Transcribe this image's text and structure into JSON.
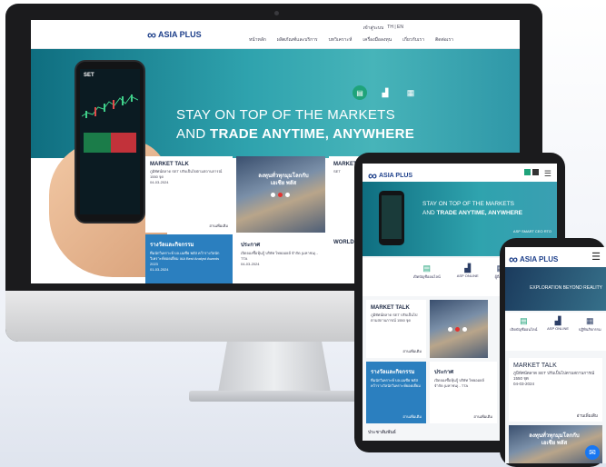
{
  "brand": {
    "logo_text": "ASIA PLUS",
    "logo_mark": "∞"
  },
  "desktop": {
    "user_bar": [
      "เข้าสู่ระบบ",
      "TH | EN"
    ],
    "nav": [
      "หน้าหลัก",
      "ผลิตภัณฑ์และบริการ",
      "บทวิเคราะห์",
      "เครื่องมือลงทุน",
      "เกี่ยวกับเรา",
      "ติดต่อเรา"
    ],
    "hero_line1": "STAY ON TOP OF THE  MARKETS",
    "hero_line2_bold": "TRADE  ANYTIME, ANYWHERE",
    "hero_line2_prefix": "AND ",
    "phone_ticker": "SET",
    "cards": [
      {
        "title": "MARKET TALK",
        "text": "ภูมิทัศน์ตลาด SET ปรับเป็นไปตามสถานการณ์ 1550 จุด",
        "date": "04-03-2024",
        "more": "อ่านเพิ่มเติม"
      },
      {
        "title": "รางวัลและกิจกรรม",
        "text": "ทีมนักวิเคราะห์ บล.เอเซีย พลัส คว้ารางวัลนักวิเคราะห์ยอดเยี่ยม IAA Best Analyst Awards 2023",
        "date": "01-03-2024"
      },
      {
        "title": "ประกาศ",
        "text": "เปิดจองซื้อหุ้นกู้ บริษัท ไทยออยล์ จำกัด (มหาชน) - TTA",
        "date": "04-03-2024"
      },
      {
        "title": "MARKET PULSE",
        "text": "SET"
      },
      {
        "title": "WORLD MARKET",
        "text": ""
      }
    ],
    "image_card_caption": "ลงทุนทั่วทุกมุมโลกกับเอเซีย พลัส"
  },
  "tablet": {
    "hero_line1": "STAY ON TOP OF THE  MARKETS",
    "hero_line2_prefix": "AND ",
    "hero_line2_bold": "TRADE  ANYTIME, ANYWHERE",
    "asp_label": "ASP SMART\nCEO RTO",
    "icons": [
      "เปิดบัญชีออนไลน์",
      "ASP ONLINE",
      "ผู้ถือหุ้น"
    ],
    "cards": [
      {
        "title": "MARKET TALK",
        "text": "ภูมิทัศน์ตลาด SET ปรับเป็นไปตามสถานการณ์ 1550 จุด",
        "more": "อ่านเพิ่มเติม"
      },
      {
        "title": "รางวัลและกิจกรรม",
        "text": "ทีมนักวิเคราะห์ บล.เอเซีย พลัส คว้ารางวัลนักวิเคราะห์ยอดเยี่ยม",
        "more": "อ่านเพิ่มเติม"
      },
      {
        "title": "ประกาศ",
        "text": "เปิดจองซื้อหุ้นกู้ บริษัท ไทยออยล์ จำกัด (มหาชน) - TTA",
        "more": "อ่านเพิ่มเติม"
      }
    ],
    "footer_label": "ประชาสัมพันธ์"
  },
  "phone": {
    "hero_text": "EXPLORATION\nBEYOND REALITY",
    "icons": [
      "เปิดบัญชีออนไลน์",
      "ASP ONLINE",
      "ปฏิทินกิจกรรม"
    ],
    "card": {
      "title": "MARKET TALK",
      "text": "ภูมิทัศน์ตลาด SET ปรับเป็นไปตามสถานการณ์ 1550 จุด",
      "date": "04-03-2024",
      "more": "อ่านเพิ่มเติม"
    },
    "image_caption": "ลงทุนทั่วทุกมุมโลกกับเอเซีย พลัส"
  },
  "colors": {
    "brand_blue": "#1d3f8a",
    "teal": "#2fa3ae",
    "green": "#1fa37a",
    "messenger": "#1877f2"
  }
}
